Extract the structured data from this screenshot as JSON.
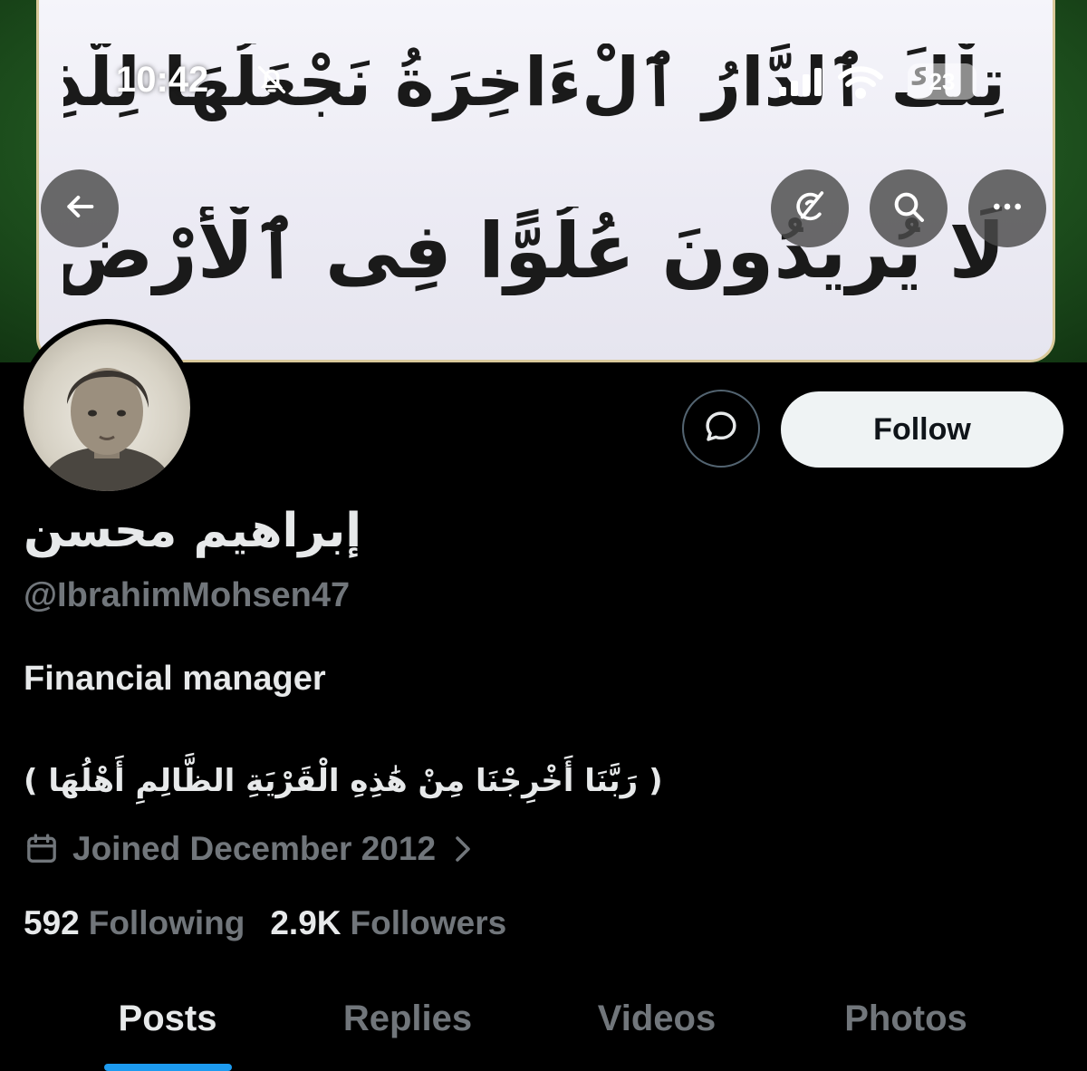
{
  "status_bar": {
    "time": "10:42",
    "battery": "23"
  },
  "banner": {
    "line1": "تِلْكَ ٱلدَّارُ ٱلْءَاخِرَةُ نَجْعَلُهَا لِلَّذِينَ",
    "line2": "لَا يُرِيدُونَ عُلُوًّا فِى ٱلْأَرْضِ وَلَا فَسَادًا"
  },
  "profile": {
    "display_name": "إبراهيم محسن",
    "handle": "@IbrahimMohsen47",
    "bio_line1": "Financial manager",
    "bio_line2": "( رَبَّنَا أَخْرِجْنَا مِنْ هَٰذِهِ الْقَرْيَةِ الظَّالِمِ أَهْلُهَا )",
    "joined": "Joined December 2012",
    "following_count": "592",
    "following_label": "Following",
    "followers_count": "2.9K",
    "followers_label": "Followers"
  },
  "actions": {
    "follow_label": "Follow"
  },
  "tabs": [
    {
      "label": "Posts",
      "active": true
    },
    {
      "label": "Replies",
      "active": false
    },
    {
      "label": "Videos",
      "active": false
    },
    {
      "label": "Photos",
      "active": false
    }
  ],
  "icons": {
    "back": "arrow-left-icon",
    "grok": "grok-icon",
    "search": "search-icon",
    "more": "more-icon",
    "message": "message-icon",
    "calendar": "calendar-icon",
    "chevron": "chevron-right-icon"
  },
  "colors": {
    "accent": "#1d9bf0",
    "secondary_text": "#71767b",
    "follow_button_bg": "#eff3f4"
  }
}
